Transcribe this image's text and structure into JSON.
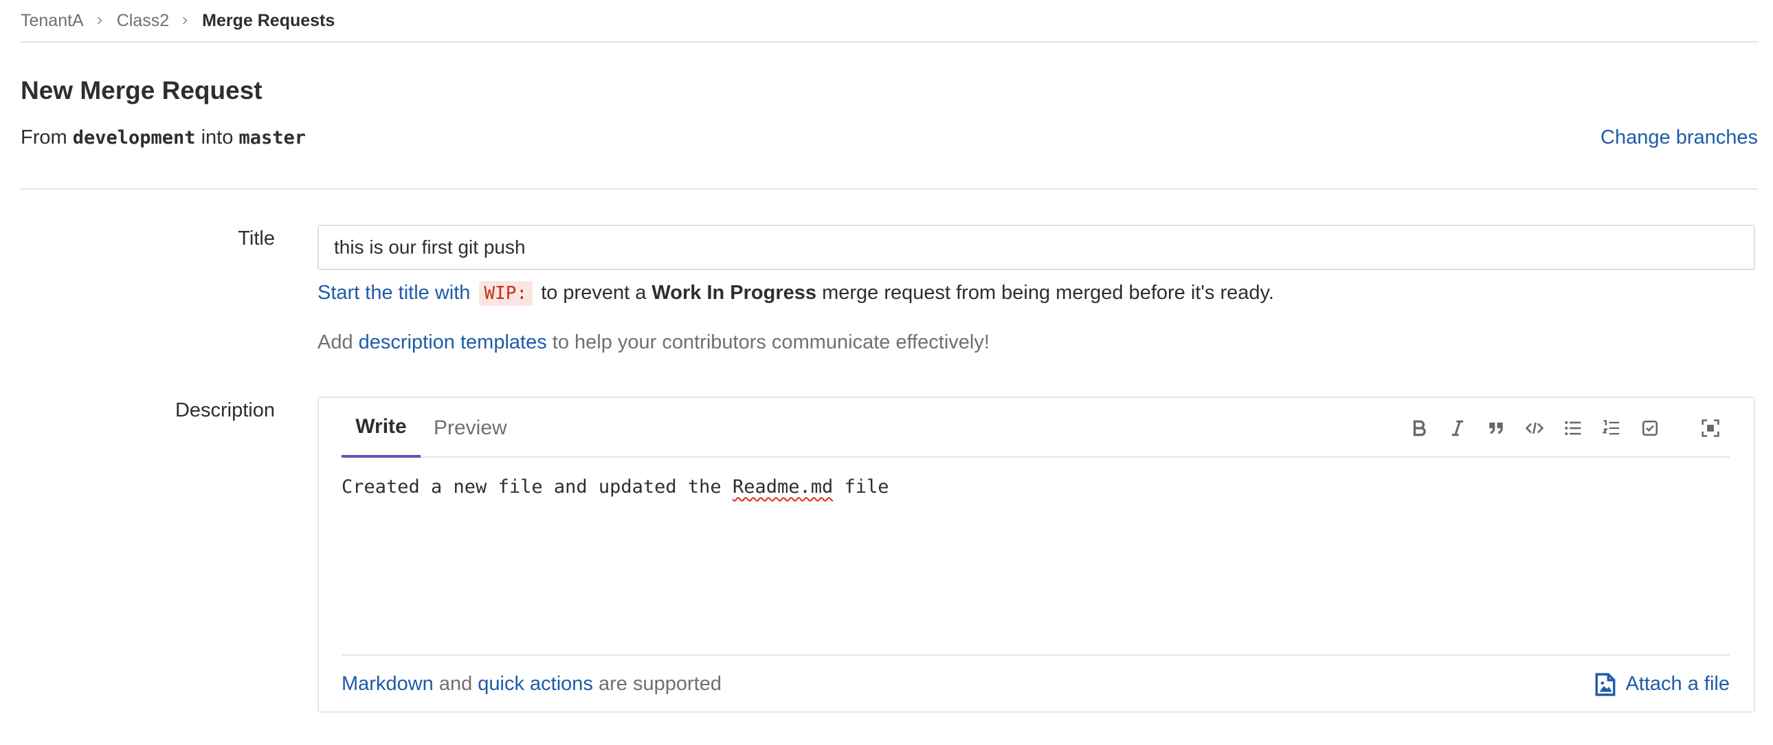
{
  "breadcrumb": {
    "items": [
      {
        "label": "TenantA"
      },
      {
        "label": "Class2"
      },
      {
        "label": "Merge Requests"
      }
    ]
  },
  "header": {
    "title": "New Merge Request",
    "from_text": "From",
    "source_branch": "development",
    "into_text": "into",
    "target_branch": "master",
    "change_branches": "Change branches"
  },
  "form": {
    "title_label": "Title",
    "title_value": "this is our first git push",
    "wip_hint": {
      "link": "Start the title with",
      "code": "WIP:",
      "pre": "to prevent a",
      "bold": "Work In Progress",
      "post": "merge request from being merged before it's ready."
    },
    "templates_hint": {
      "pre": "Add",
      "link": "description templates",
      "post": "to help your contributors communicate effectively!"
    },
    "description_label": "Description",
    "tabs": {
      "write": "Write",
      "preview": "Preview"
    },
    "description_value": {
      "before": "Created a new file and updated the ",
      "misspelled": "Readme.md",
      "after": " file"
    },
    "toolbar": [
      "bold-icon",
      "italic-icon",
      "quote-icon",
      "code-icon",
      "bullet-list-icon",
      "numbered-list-icon",
      "task-list-icon",
      "fullscreen-icon"
    ],
    "footer": {
      "markdown": "Markdown",
      "and": "and",
      "quick_actions": "quick actions",
      "supported": "are supported",
      "attach": "Attach a file"
    }
  },
  "colors": {
    "link": "#1f5ba8",
    "active_tab": "#6b4fbb",
    "wip_code": "#c0341d"
  }
}
